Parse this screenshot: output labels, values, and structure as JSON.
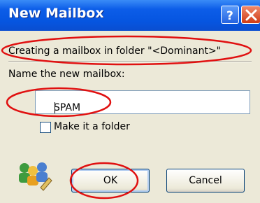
{
  "window": {
    "title": "New Mailbox",
    "help_button": "?",
    "close_button": "X"
  },
  "message": "Creating a mailbox in folder \"<Dominant>\"",
  "name_label": "Name the new mailbox:",
  "name_input": {
    "value": "SPAM"
  },
  "folder_checkbox": {
    "label": "Make it a folder",
    "checked": false
  },
  "buttons": {
    "ok": "OK",
    "cancel": "Cancel"
  },
  "annotations": {
    "color": "#e01010"
  },
  "icons": {
    "dialog": "users-icon"
  }
}
